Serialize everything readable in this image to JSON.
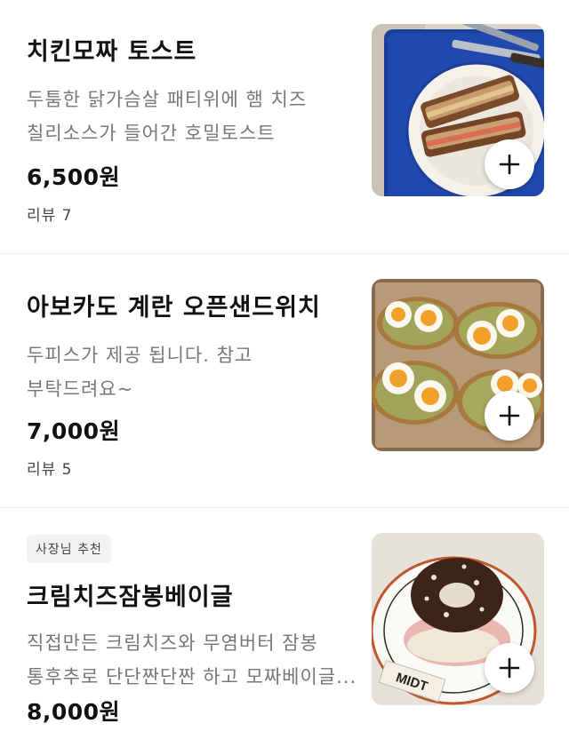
{
  "menu": {
    "items": [
      {
        "name": "치킨모짜 토스트",
        "desc_lines": [
          "두툼한 닭가슴살 패티위에 햄 치즈",
          "칠리소스가 들어간 호밀토스트"
        ],
        "price": "6,500원",
        "review": "리뷰 7",
        "image_icon": "toast-photo",
        "add_icon": "plus-icon"
      },
      {
        "name": "아보카도 계란 오픈샌드위치",
        "desc_lines": [
          "두피스가 제공 됩니다. 참고",
          "부탁드려요~"
        ],
        "price": "7,000원",
        "review": "리뷰 5",
        "image_icon": "sandwich-photo",
        "add_icon": "plus-icon"
      },
      {
        "badge": "사장님 추천",
        "name": "크림치즈잠봉베이글",
        "desc_lines": [
          "직접만든 크림치즈와 무염버터 잠봉",
          "통후추로 단단짠단짠 하고 모짜베이글..."
        ],
        "price": "8,000원",
        "image_icon": "bagel-photo",
        "plate_text": "MIDT",
        "add_icon": "plus-icon"
      }
    ]
  },
  "colors": {
    "tray_blue": "#1c3f9c",
    "text_gray": "#777777",
    "divider": "#ececec",
    "badge_bg": "#f1f2f4"
  }
}
